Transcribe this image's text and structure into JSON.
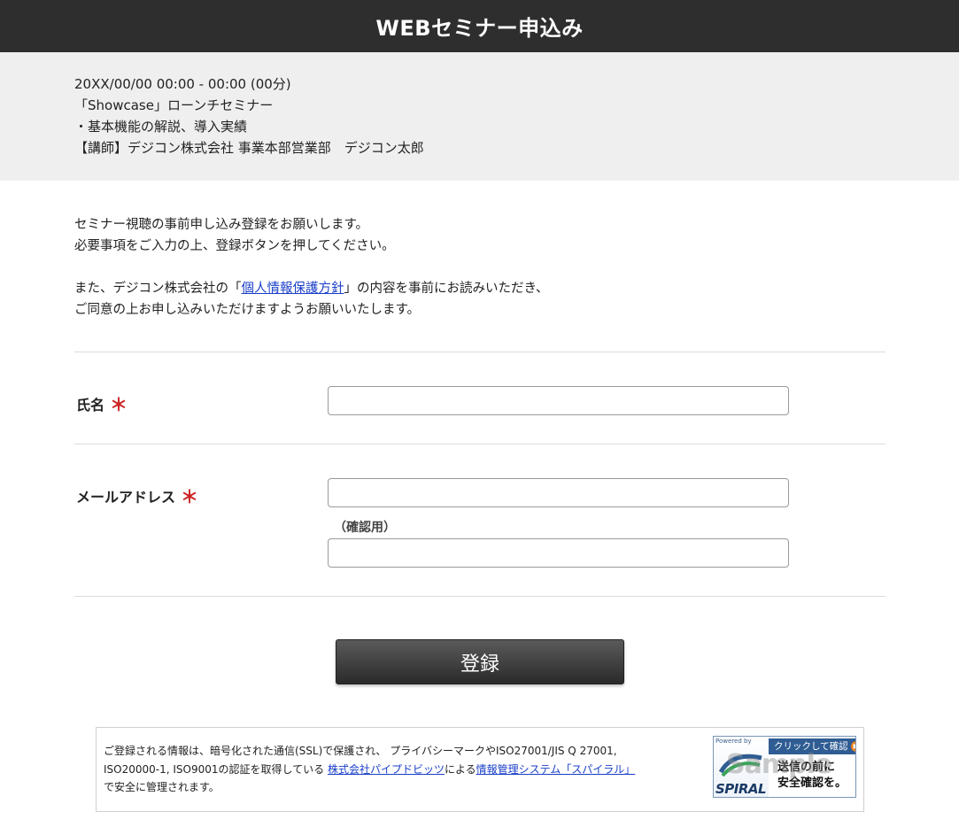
{
  "header": {
    "title": "WEBセミナー申込み"
  },
  "seminar": {
    "datetime": "20XX/00/00 00:00 - 00:00 (00分)",
    "name": "「Showcase」ローンチセミナー",
    "topic": "・基本機能の解説、導入実績",
    "speaker": "【講師】デジコン株式会社 事業本部営業部　デジコン太郎"
  },
  "intro": {
    "line1": "セミナー視聴の事前申し込み登録をお願いします。",
    "line2": "必要事項をご入力の上、登録ボタンを押してください。",
    "line3_before": "また、デジコン株式会社の「",
    "policy_link": "個人情報保護方針",
    "line3_after": "」の内容を事前にお読みいただき、",
    "line4": "ご同意の上お申し込みいただけますようお願いいたします。"
  },
  "form": {
    "name_label": "氏名",
    "required_mark": "＊",
    "email_label": "メールアドレス",
    "confirm_label": "（確認用）",
    "name_value": "",
    "email_value": "",
    "confirm_value": ""
  },
  "submit": {
    "label": "登録"
  },
  "security": {
    "line1": "ご登録される情報は、暗号化された通信(SSL)で保護され、 プライバシーマークやISO27001/JIS Q 27001,",
    "line2_before": "ISO20000-1, ISO9001の認証を取得している ",
    "company_link": "株式会社パイプドビッツ",
    "line2_middle": "による",
    "system_link": "情報管理システム「スパイラル」",
    "line3": "で安全に管理されます。"
  },
  "badge": {
    "powered": "Powered by",
    "logo": "SPIRAL",
    "click_text": "クリックして確認",
    "arrow": "▶",
    "msg_line1": "送信の前に",
    "msg_line2": "安全確認を。",
    "watermark": "Sample"
  },
  "colors": {
    "header_bg": "#2e2e2e",
    "info_bg": "#efefef",
    "required": "#cc2222",
    "link": "#1a3ec8",
    "badge_blue": "#2f5d93",
    "badge_orange": "#f07f1c"
  }
}
